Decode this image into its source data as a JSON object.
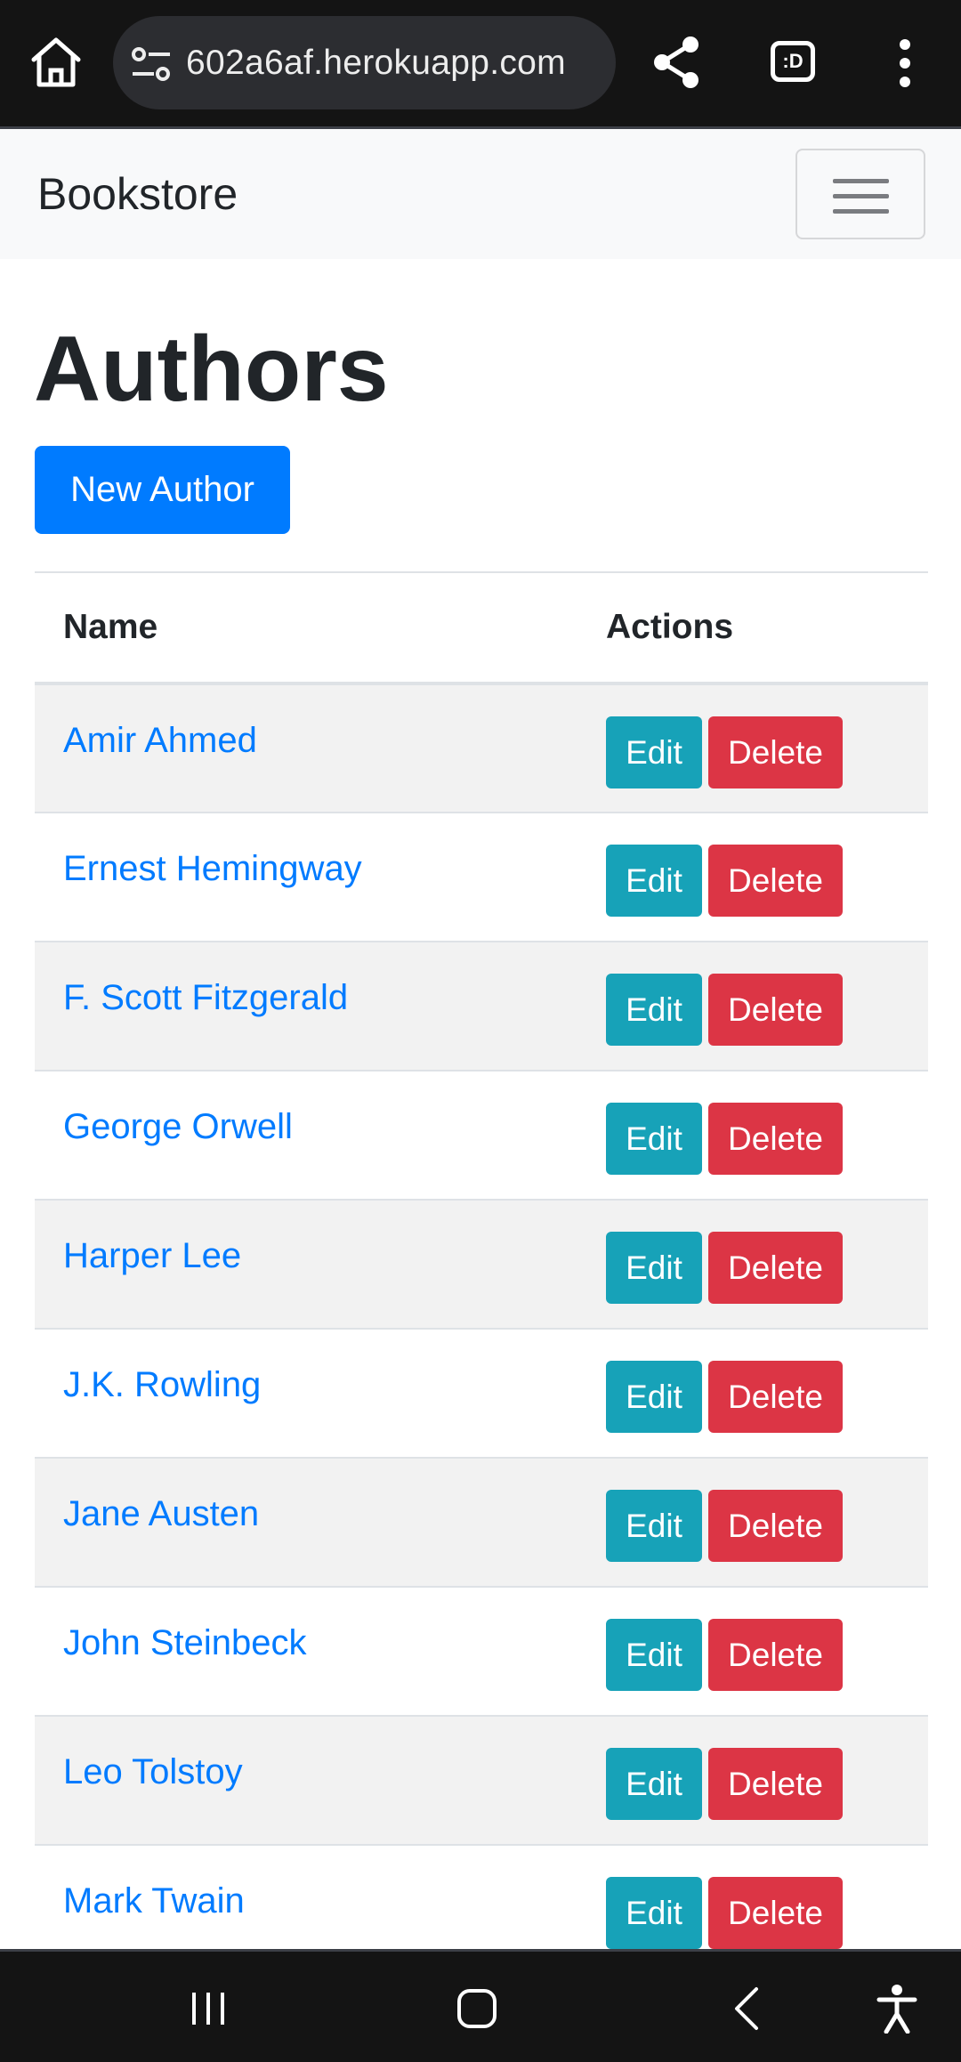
{
  "browser": {
    "url": "602a6af.herokuapp.com",
    "tabs_label": ":D"
  },
  "navbar": {
    "brand": "Bookstore"
  },
  "main": {
    "title": "Authors",
    "new_button": "New Author",
    "table": {
      "headers": [
        "Name",
        "Actions"
      ],
      "rows": [
        {
          "name": "Amir Ahmed"
        },
        {
          "name": "Ernest Hemingway"
        },
        {
          "name": "F. Scott Fitzgerald"
        },
        {
          "name": "George Orwell"
        },
        {
          "name": "Harper Lee"
        },
        {
          "name": "J.K. Rowling"
        },
        {
          "name": "Jane Austen"
        },
        {
          "name": "John Steinbeck"
        },
        {
          "name": "Leo Tolstoy"
        },
        {
          "name": "Mark Twain"
        }
      ],
      "edit_label": "Edit",
      "delete_label": "Delete"
    }
  },
  "colors": {
    "primary": "#007bff",
    "info": "#17a2b8",
    "danger": "#dc3545",
    "browser_chrome": "#141414"
  },
  "icons": {
    "browser": [
      "home-icon",
      "site-settings-icon",
      "share-icon",
      "tabs-icon",
      "more-vert-icon"
    ],
    "system": [
      "recents-icon",
      "home-icon",
      "back-icon",
      "accessibility-icon"
    ]
  }
}
